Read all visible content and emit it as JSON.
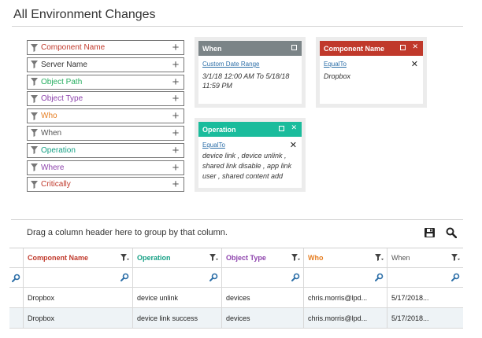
{
  "page": {
    "title": "All Environment Changes"
  },
  "filters": [
    {
      "label": "Component Name",
      "color": "#c0392b"
    },
    {
      "label": "Server Name",
      "color": "#333333"
    },
    {
      "label": "Object Path",
      "color": "#27ae60"
    },
    {
      "label": "Object Type",
      "color": "#8e44ad"
    },
    {
      "label": "Who",
      "color": "#e67e22"
    },
    {
      "label": "When",
      "color": "#555555"
    },
    {
      "label": "Operation",
      "color": "#16a085"
    },
    {
      "label": "Where",
      "color": "#8e44ad"
    },
    {
      "label": "Critically",
      "color": "#c0392b"
    }
  ],
  "cards": {
    "when": {
      "title": "When",
      "link": "Custom Date Range",
      "value": "3/1/18 12:00 AM To 5/18/18 11:59 PM",
      "color": "#7b8487"
    },
    "component": {
      "title": "Component Name",
      "link": "EqualTo",
      "value": "Dropbox",
      "color": "#c0392b"
    },
    "operation": {
      "title": "Operation",
      "link": "EqualTo",
      "value": "device link , device unlink , shared link disable , app link user , shared content add",
      "color": "#1abc9c"
    }
  },
  "grid": {
    "group_hint": "Drag a column header here to group by that column.",
    "columns": [
      {
        "label": "Component Name",
        "color": "#c0392b"
      },
      {
        "label": "Operation",
        "color": "#16a085"
      },
      {
        "label": "Object Type",
        "color": "#8e44ad"
      },
      {
        "label": "Who",
        "color": "#e67e22"
      },
      {
        "label": "When",
        "color": "#555555"
      }
    ],
    "rows": [
      [
        "Dropbox",
        "device unlink",
        "devices",
        "chris.morris@lpd...",
        "5/17/2018..."
      ],
      [
        "Dropbox",
        "device link success",
        "devices",
        "chris.morris@lpd...",
        "5/17/2018..."
      ]
    ]
  },
  "colors": {
    "accent_blue": "#2d6fa8"
  }
}
